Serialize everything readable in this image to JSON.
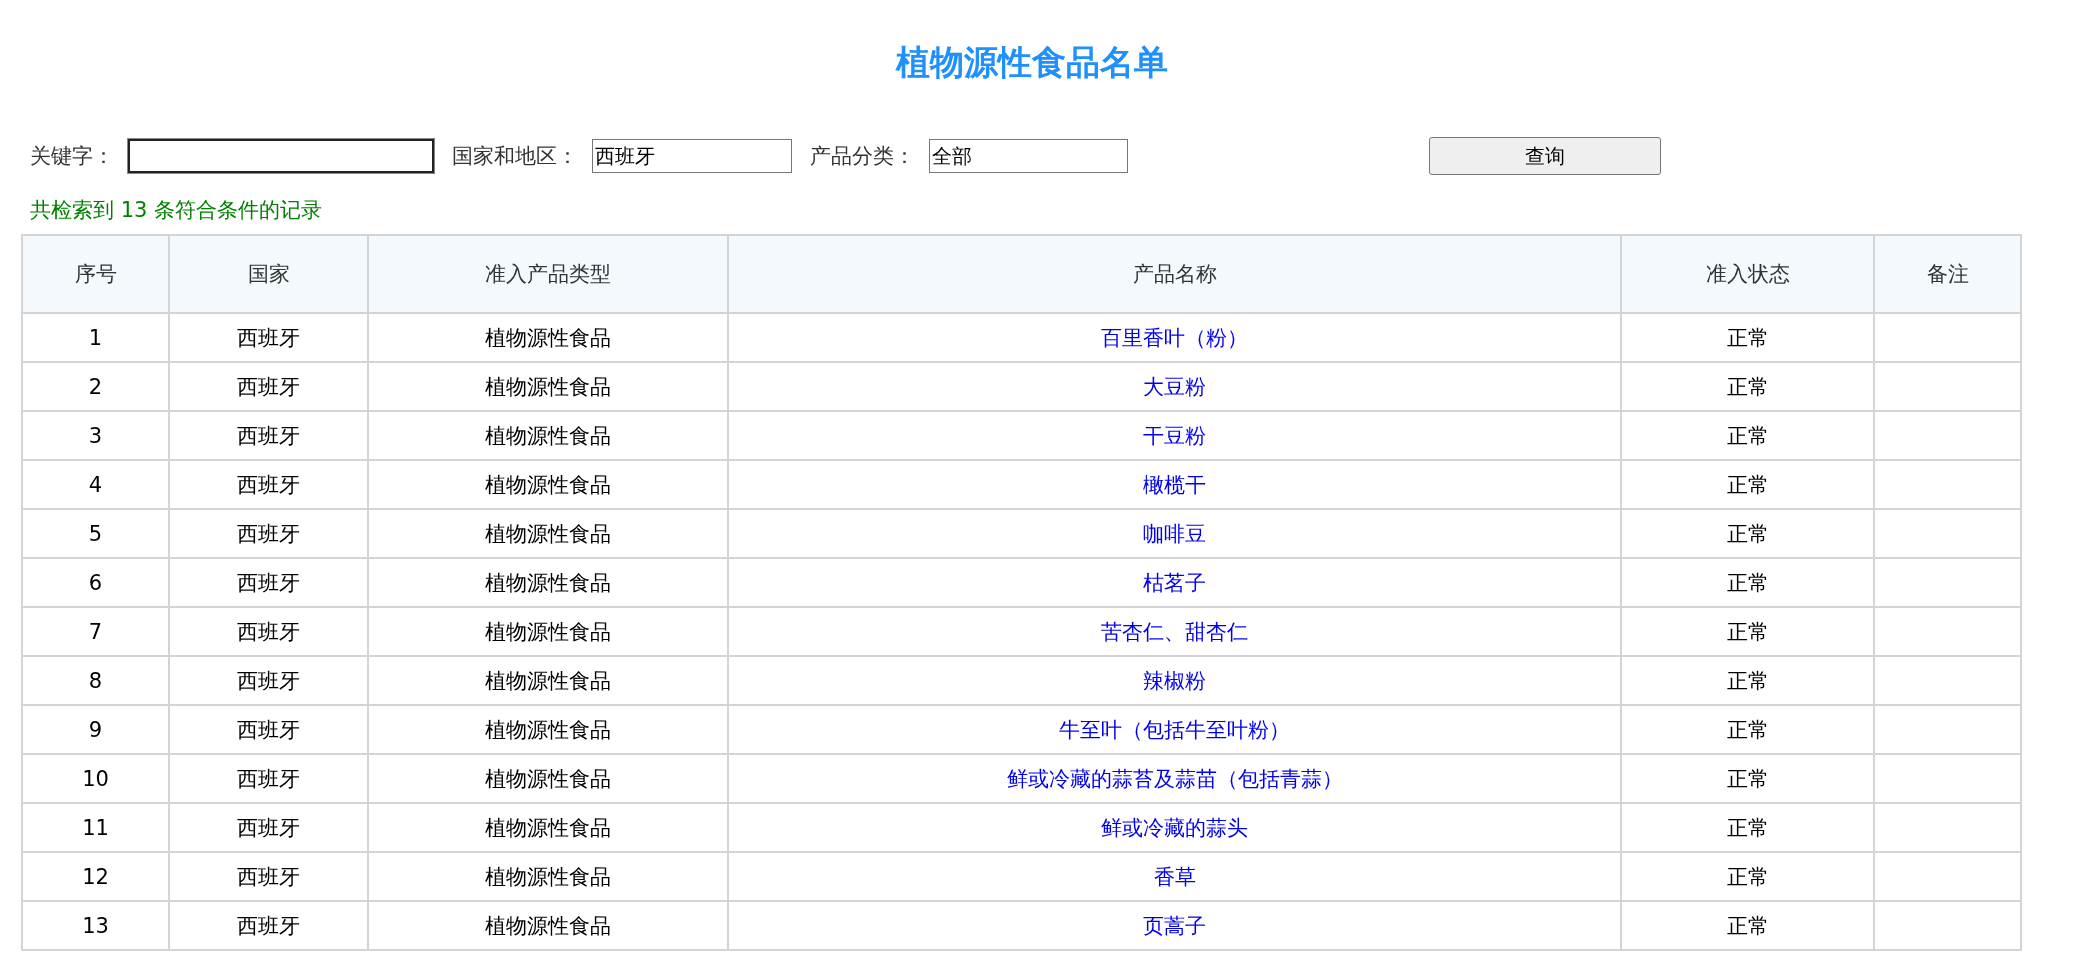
{
  "title": "植物源性食品名单",
  "search": {
    "fields": [
      {
        "label": "关键字：",
        "focused": true
      },
      {
        "label": "国家和地区：",
        "value": "西班牙",
        "focused": false
      },
      {
        "label": "产品分类：",
        "value": "全部",
        "focused": false
      }
    ],
    "button": "查询"
  },
  "result_count": "共检索到 13 条符合条件的记录",
  "table": {
    "columns": [
      "序号",
      "国家",
      "准入产品类型",
      "产品名称",
      "准入状态",
      "备注"
    ],
    "rows": [
      {
        "no": "1",
        "country": "西班牙",
        "type": "植物源性食品",
        "name": "百里香叶（粉）",
        "status": "正常"
      },
      {
        "no": "2",
        "country": "西班牙",
        "type": "植物源性食品",
        "name": "大豆粉",
        "status": "正常"
      },
      {
        "no": "3",
        "country": "西班牙",
        "type": "植物源性食品",
        "name": "干豆粉",
        "status": "正常"
      },
      {
        "no": "4",
        "country": "西班牙",
        "type": "植物源性食品",
        "name": "橄榄干",
        "status": "正常"
      },
      {
        "no": "5",
        "country": "西班牙",
        "type": "植物源性食品",
        "name": "咖啡豆",
        "status": "正常"
      },
      {
        "no": "6",
        "country": "西班牙",
        "type": "植物源性食品",
        "name": "枯茗子",
        "status": "正常"
      },
      {
        "no": "7",
        "country": "西班牙",
        "type": "植物源性食品",
        "name": "苦杏仁、甜杏仁",
        "status": "正常"
      },
      {
        "no": "8",
        "country": "西班牙",
        "type": "植物源性食品",
        "name": "辣椒粉",
        "status": "正常"
      },
      {
        "no": "9",
        "country": "西班牙",
        "type": "植物源性食品",
        "name": "牛至叶（包括牛至叶粉）",
        "status": "正常"
      },
      {
        "no": "10",
        "country": "西班牙",
        "type": "植物源性食品",
        "name": "鲜或冷藏的蒜苔及蒜苗（包括青蒜）",
        "status": "正常"
      },
      {
        "no": "11",
        "country": "西班牙",
        "type": "植物源性食品",
        "name": "鲜或冷藏的蒜头",
        "status": "正常"
      },
      {
        "no": "12",
        "country": "西班牙",
        "type": "植物源性食品",
        "name": "香草",
        "status": "正常"
      },
      {
        "no": "13",
        "country": "西班牙",
        "type": "植物源性食品",
        "name": "页蒿子",
        "status": "正常"
      }
    ]
  }
}
